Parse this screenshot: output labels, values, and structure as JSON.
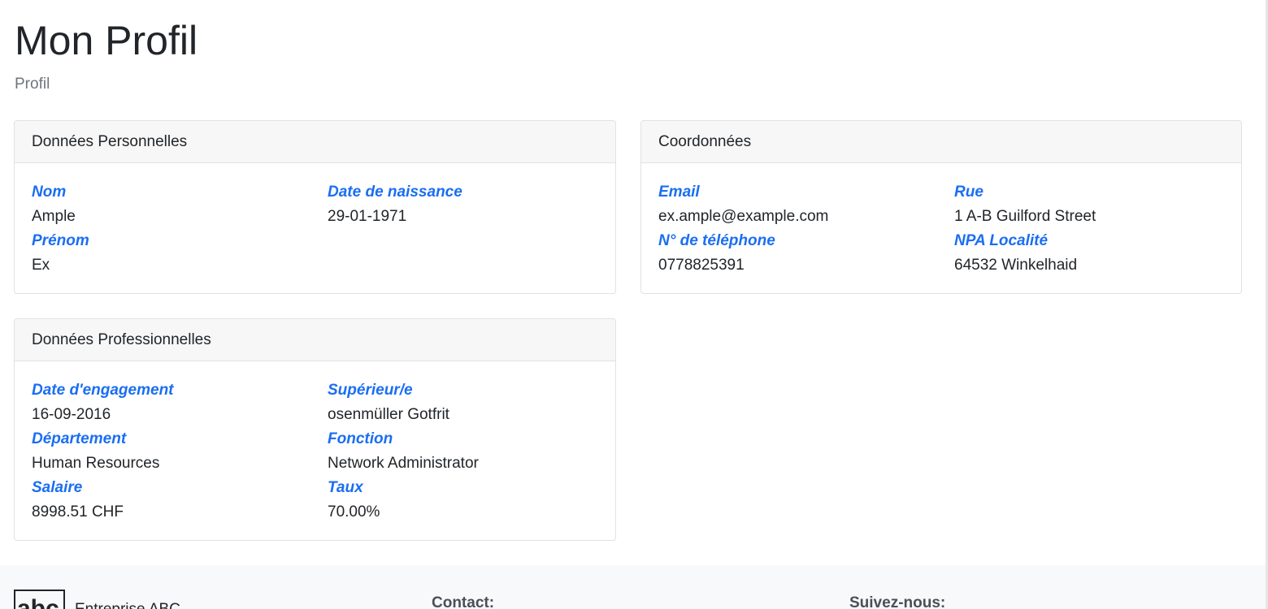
{
  "header": {
    "title": "Mon Profil",
    "breadcrumb": "Profil"
  },
  "personal": {
    "title": "Données Personnelles",
    "nom_label": "Nom",
    "nom_value": "Ample",
    "prenom_label": "Prénom",
    "prenom_value": "Ex",
    "dob_label": "Date de naissance",
    "dob_value": "29-01-1971"
  },
  "contact": {
    "title": "Coordonnées",
    "email_label": "Email",
    "email_value": "ex.ample@example.com",
    "phone_label": "N° de téléphone",
    "phone_value": "0778825391",
    "street_label": "Rue",
    "street_value": "1 A-B Guilford Street",
    "locality_label": "NPA Localité",
    "locality_value": "64532 Winkelhaid"
  },
  "professional": {
    "title": "Données Professionnelles",
    "hire_label": "Date d'engagement",
    "hire_value": "16-09-2016",
    "department_label": "Département",
    "department_value": "Human Resources",
    "salary_label": "Salaire",
    "salary_value": "8998.51 CHF",
    "superior_label": "Supérieur/e",
    "superior_value": "osenmüller Gotfrit",
    "function_label": "Fonction",
    "function_value": "Network Administrator",
    "rate_label": "Taux",
    "rate_value": "70.00%"
  },
  "footer": {
    "logo_text": "abc",
    "company": "Entreprise ABC",
    "contact_heading": "Contact:",
    "follow_heading": "Suivez-nous:"
  },
  "colors": {
    "label_accent": "#1a6ef2",
    "card_header_bg": "#f7f7f7",
    "footer_bg": "#f8f9fa"
  }
}
